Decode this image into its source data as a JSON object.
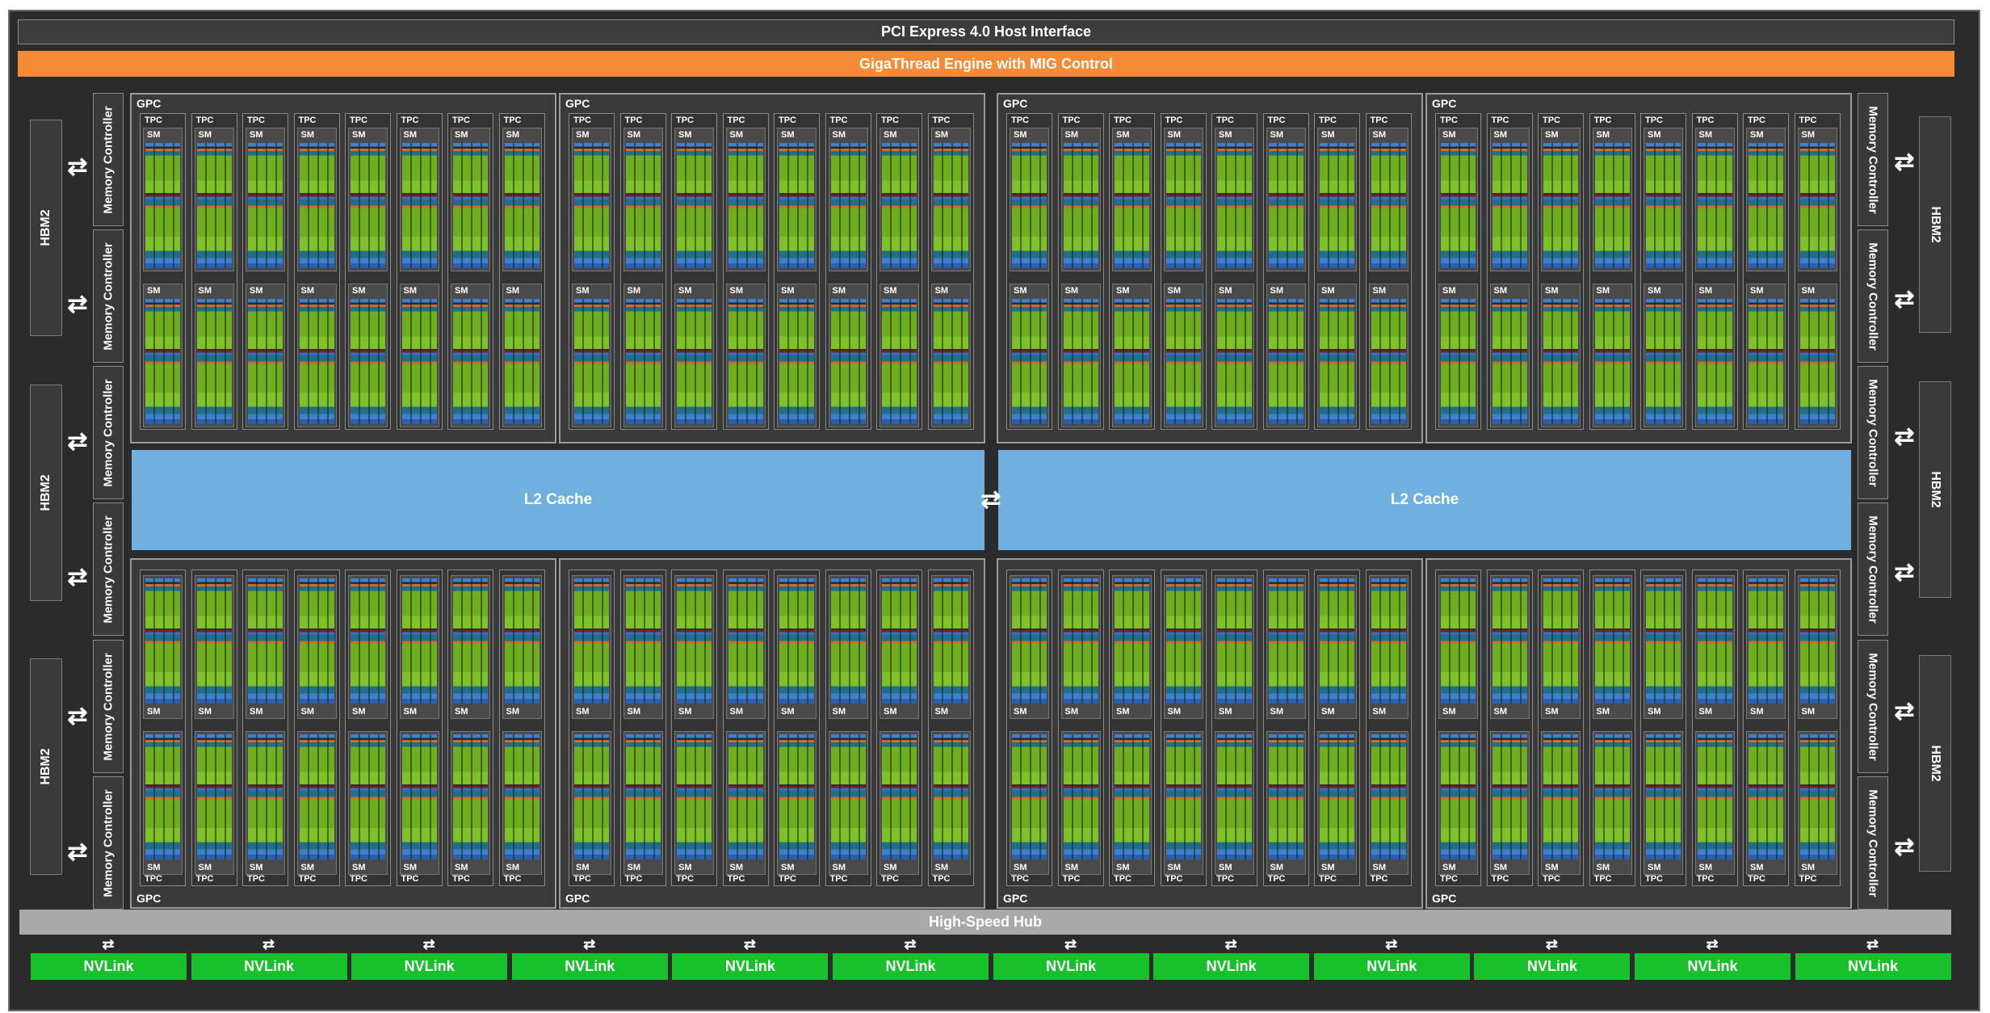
{
  "pcie_label": "PCI Express 4.0 Host Interface",
  "gigathread_label": "GigaThread Engine with MIG Control",
  "hub_label": "High-Speed Hub",
  "l2_label": "L2 Cache",
  "hbm_label": "HBM2",
  "memory_controller_label": "Memory Controller",
  "gpc_label": "GPC",
  "tpc_label": "TPC",
  "sm_label": "SM",
  "nvlink_label": "NVLink",
  "arrow_glyph": "⇄",
  "counts": {
    "gpcs": 8,
    "tpcs_per_gpc": 8,
    "sms_per_tpc": 2,
    "hbm_stacks": 6,
    "memory_controllers": 12,
    "nvlinks": 12
  },
  "colors": {
    "chip": "#2b2b2b",
    "gigathread": "#f58c35",
    "l2": "#6fb0de",
    "nvlink": "#18c12b",
    "hub": "#a9a9a9",
    "cuda_cores": "#6fae1f"
  }
}
